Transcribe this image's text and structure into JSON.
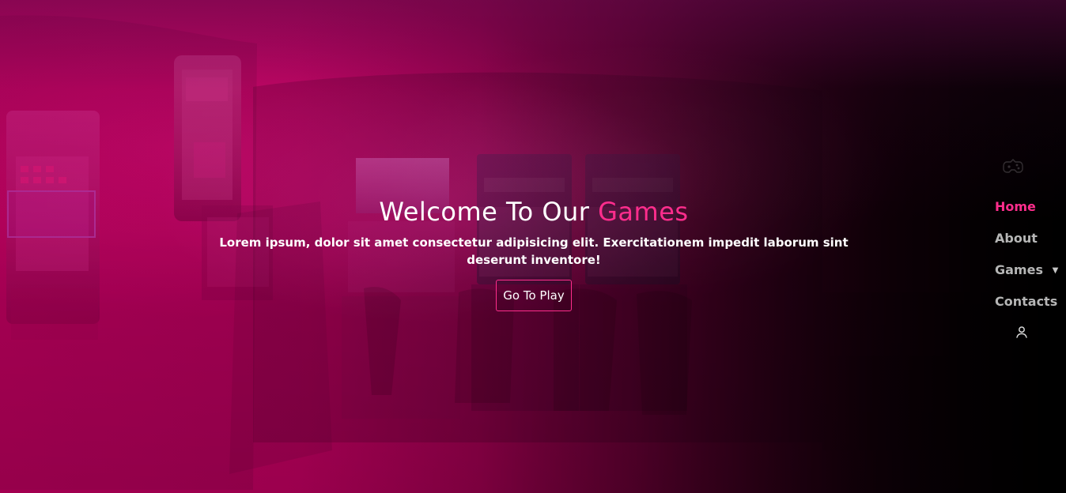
{
  "hero": {
    "title_prefix": "Welcome To Our",
    "title_accent": "Games",
    "subtitle": "Lorem ipsum, dolor sit amet consectetur adipisicing elit. Exercitationem impedit laborum sint deserunt inventore!",
    "button_label": "Go To Play"
  },
  "navigation": {
    "items": [
      {
        "label": "Home",
        "active": true
      },
      {
        "label": "About",
        "active": false
      },
      {
        "label": "Games",
        "active": false
      },
      {
        "label": "Contacts",
        "active": false
      }
    ],
    "user_icon": "user-icon",
    "logo_icon": "gamepad-icon"
  },
  "colors": {
    "accent": "#ff2d8d",
    "nav_text": "#b6b6b6",
    "white": "#ffffff"
  }
}
